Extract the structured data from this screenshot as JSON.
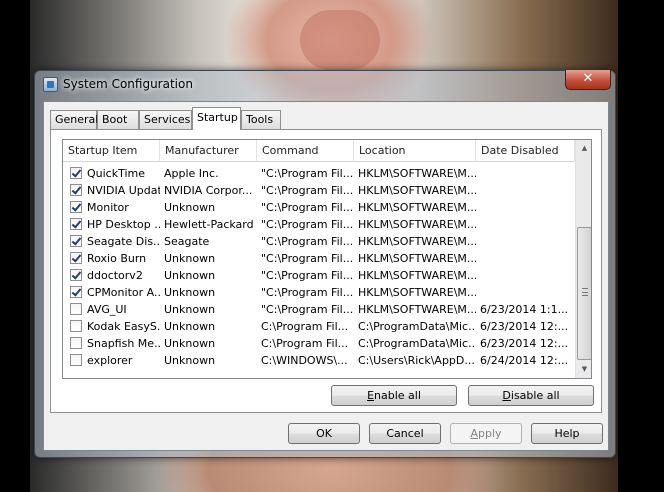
{
  "window": {
    "title": "System Configuration",
    "close_glyph": "✕"
  },
  "tabs": [
    {
      "label": "General",
      "active": false
    },
    {
      "label": "Boot",
      "active": false
    },
    {
      "label": "Services",
      "active": false
    },
    {
      "label": "Startup",
      "active": true
    },
    {
      "label": "Tools",
      "active": false
    }
  ],
  "startup_list": {
    "columns": [
      "Startup Item",
      "Manufacturer",
      "Command",
      "Location",
      "Date Disabled"
    ],
    "rows": [
      {
        "checked": true,
        "item": "QuickTime",
        "manufacturer": "Apple Inc.",
        "command": "\"C:\\Program Fil...",
        "location": "HKLM\\SOFTWARE\\M...",
        "date_disabled": ""
      },
      {
        "checked": true,
        "item": "NVIDIA Update",
        "manufacturer": "NVIDIA Corpor...",
        "command": "\"C:\\Program Fil...",
        "location": "HKLM\\SOFTWARE\\M...",
        "date_disabled": ""
      },
      {
        "checked": true,
        "item": "Monitor",
        "manufacturer": "Unknown",
        "command": "\"C:\\Program Fil...",
        "location": "HKLM\\SOFTWARE\\M...",
        "date_disabled": ""
      },
      {
        "checked": true,
        "item": "HP Desktop ...",
        "manufacturer": "Hewlett-Packard",
        "command": "\"C:\\Program Fil...",
        "location": "HKLM\\SOFTWARE\\M...",
        "date_disabled": ""
      },
      {
        "checked": true,
        "item": "Seagate Dis...",
        "manufacturer": "Seagate",
        "command": "\"C:\\Program Fil...",
        "location": "HKLM\\SOFTWARE\\M...",
        "date_disabled": ""
      },
      {
        "checked": true,
        "item": "Roxio Burn",
        "manufacturer": "Unknown",
        "command": "\"C:\\Program Fil...",
        "location": "HKLM\\SOFTWARE\\M...",
        "date_disabled": ""
      },
      {
        "checked": true,
        "item": "ddoctorv2",
        "manufacturer": "Unknown",
        "command": "\"C:\\Program Fil...",
        "location": "HKLM\\SOFTWARE\\M...",
        "date_disabled": ""
      },
      {
        "checked": true,
        "item": "CPMonitor A...",
        "manufacturer": "Unknown",
        "command": "\"C:\\Program Fil...",
        "location": "HKLM\\SOFTWARE\\M...",
        "date_disabled": ""
      },
      {
        "checked": false,
        "item": "AVG_UI",
        "manufacturer": "Unknown",
        "command": "\"C:\\Program Fil...",
        "location": "HKLM\\SOFTWARE\\M...",
        "date_disabled": "6/23/2014 1:1..."
      },
      {
        "checked": false,
        "item": "Kodak EasyS...",
        "manufacturer": "Unknown",
        "command": "C:\\Program Fil...",
        "location": "C:\\ProgramData\\Mic...",
        "date_disabled": "6/23/2014 12:..."
      },
      {
        "checked": false,
        "item": "Snapfish Me...",
        "manufacturer": "Unknown",
        "command": "C:\\Program Fil...",
        "location": "C:\\ProgramData\\Mic...",
        "date_disabled": "6/23/2014 12:..."
      },
      {
        "checked": false,
        "item": "explorer",
        "manufacturer": "Unknown",
        "command": "C:\\WINDOWS\\...",
        "location": "C:\\Users\\Rick\\AppD...",
        "date_disabled": "6/24/2014 12:..."
      }
    ]
  },
  "buttons": {
    "enable_all": {
      "accel": "E",
      "rest": "nable all"
    },
    "disable_all": {
      "accel": "D",
      "rest": "isable all"
    },
    "ok": "OK",
    "cancel": "Cancel",
    "apply": {
      "accel": "A",
      "rest": "pply"
    },
    "help": "Help"
  },
  "icons": {
    "scroll_up": "▲",
    "scroll_down": "▼"
  }
}
